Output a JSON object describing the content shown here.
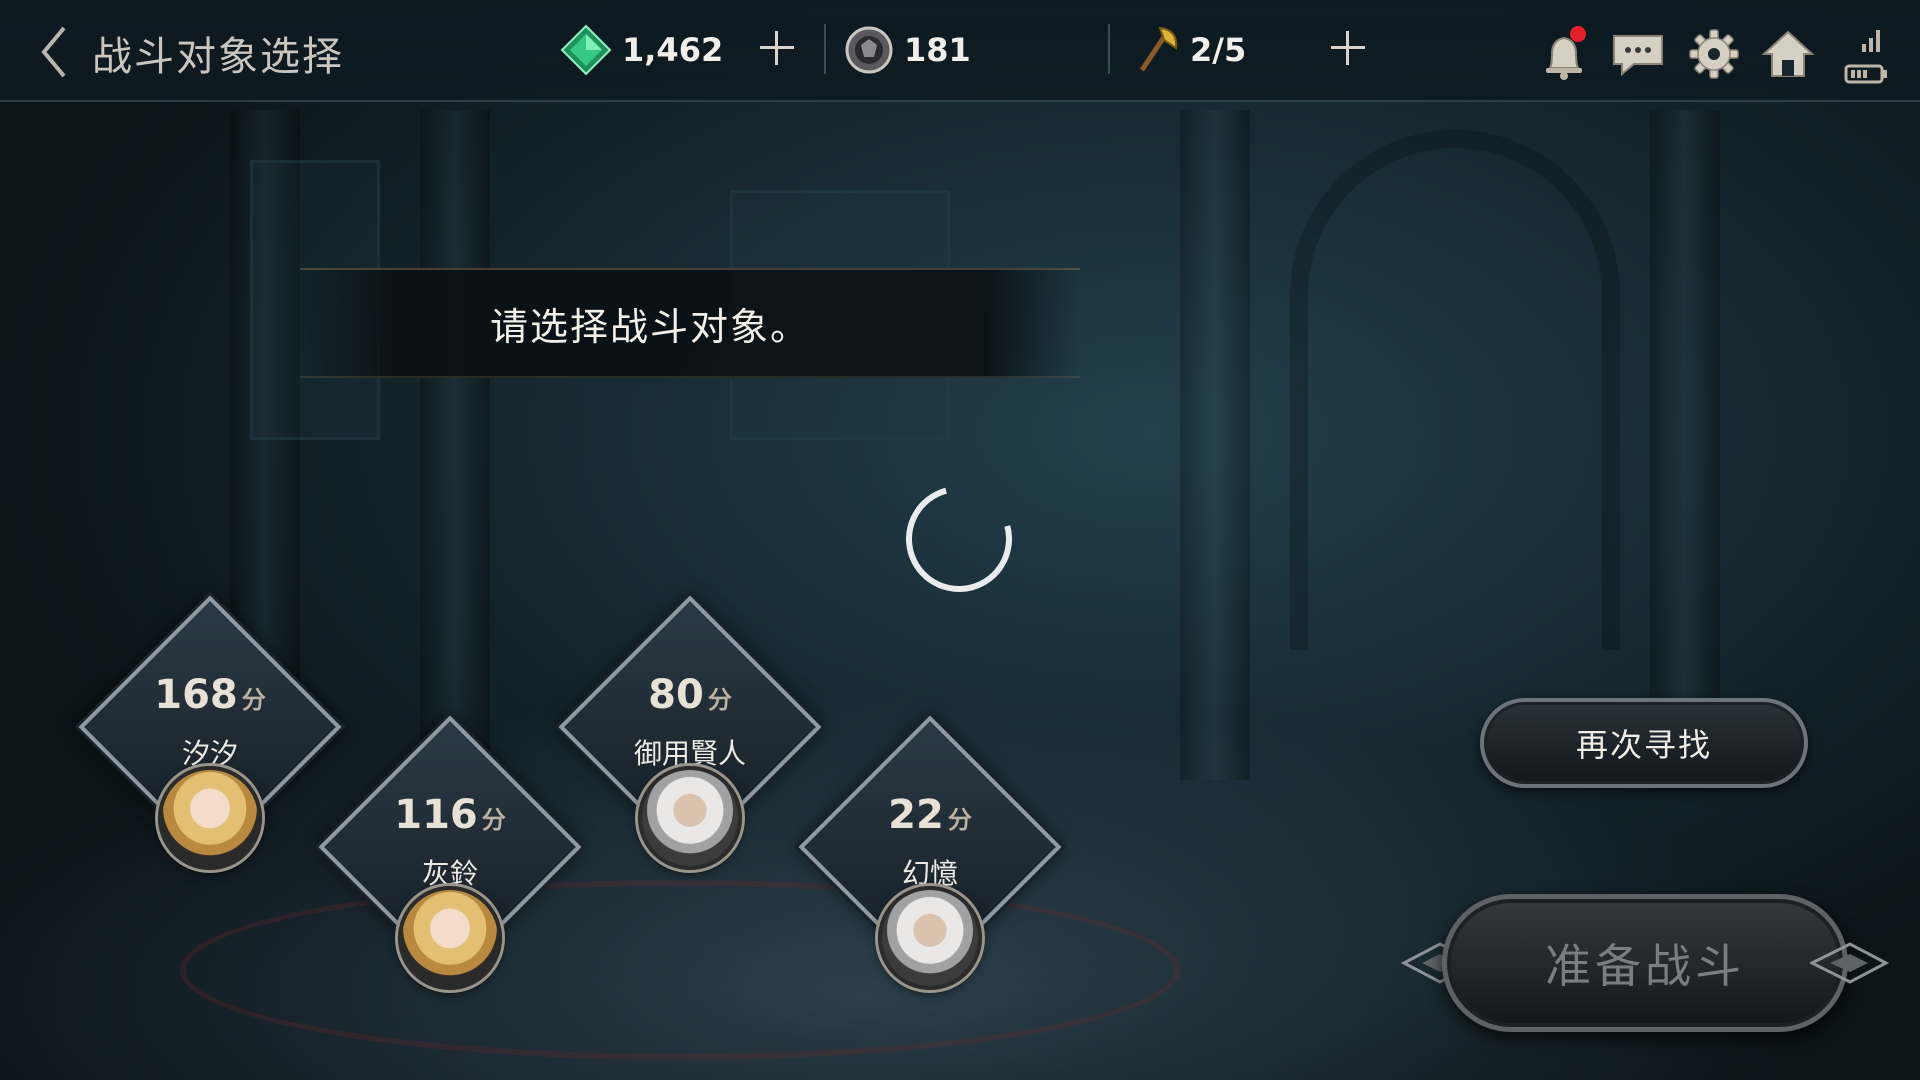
{
  "header": {
    "title": "战斗对象选择",
    "gems": "1,462",
    "medals": "181",
    "tickets": "2/5"
  },
  "prompt": "请选择战斗对象。",
  "opponents": [
    {
      "score": "168",
      "unit": "分",
      "name": "汐汐",
      "portrait": "blonde-female"
    },
    {
      "score": "116",
      "unit": "分",
      "name": "灰鈴",
      "portrait": "blonde-female"
    },
    {
      "score": "80",
      "unit": "分",
      "name": "御用賢人",
      "portrait": "silver-haired-male"
    },
    {
      "score": "22",
      "unit": "分",
      "name": "幻憶",
      "portrait": "silver-haired-male"
    }
  ],
  "buttons": {
    "research": "再次寻找",
    "ready": "准备战斗"
  },
  "icons": [
    "back-icon",
    "gem-icon",
    "plus-icon",
    "medal-icon",
    "axe-icon",
    "bell-icon",
    "chat-icon",
    "gear-icon",
    "home-icon",
    "signal-icon",
    "battery-icon"
  ],
  "colors": {
    "notification_dot": "#e3202a",
    "gem": "#2fbf7f",
    "ready_text_disabled": "#7b7e80"
  }
}
